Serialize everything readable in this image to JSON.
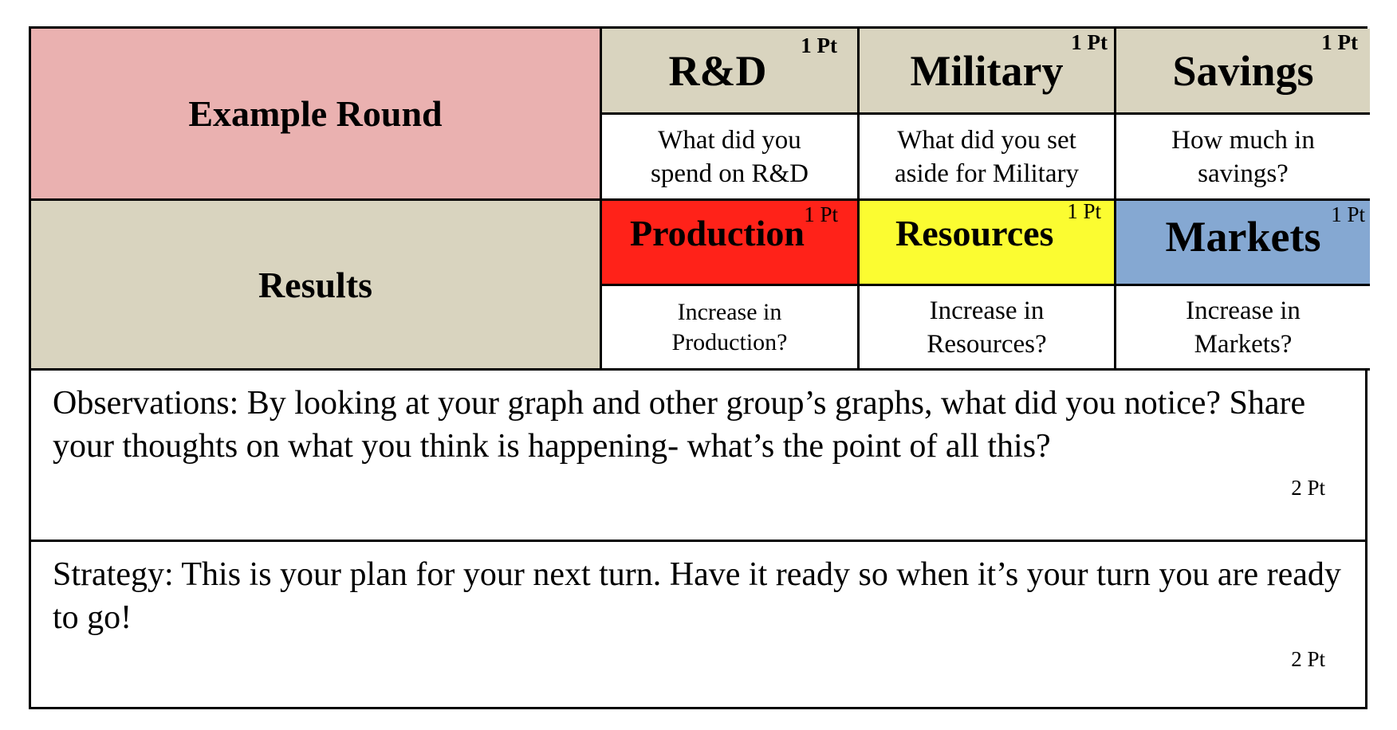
{
  "row_labels": {
    "example_round": "Example Round",
    "results": "Results"
  },
  "colors": {
    "example_round_bg": "#eab1b0",
    "header_bg": "#d9d4bf",
    "production_bg": "#ff2219",
    "resources_bg": "#fbfc31",
    "markets_bg": "#85a8d2"
  },
  "decisions": [
    {
      "title": "R&D",
      "points": "1 Pt",
      "question": "What did you spend on R&D"
    },
    {
      "title": "Military",
      "points": "1 Pt",
      "question": "What did you set aside for Military"
    },
    {
      "title": "Savings",
      "points": "1 Pt",
      "question": "How much in savings?"
    }
  ],
  "results": [
    {
      "title": "Production",
      "points": "1 Pt",
      "question": "Increase in Production?"
    },
    {
      "title": "Resources",
      "points": "1 Pt",
      "question": "Increase in Resources?"
    },
    {
      "title": "Markets",
      "points": "1 Pt",
      "question": "Increase in Markets?"
    }
  ],
  "observations": {
    "text": "Observations:  By looking at your graph and other group’s graphs, what did you notice?  Share your thoughts on what you think is happening- what’s the point of all this?",
    "points": "2 Pt"
  },
  "strategy": {
    "text": "Strategy:  This is your plan for your next turn.  Have it ready so when it’s your turn you are ready to go!",
    "points": "2 Pt"
  }
}
